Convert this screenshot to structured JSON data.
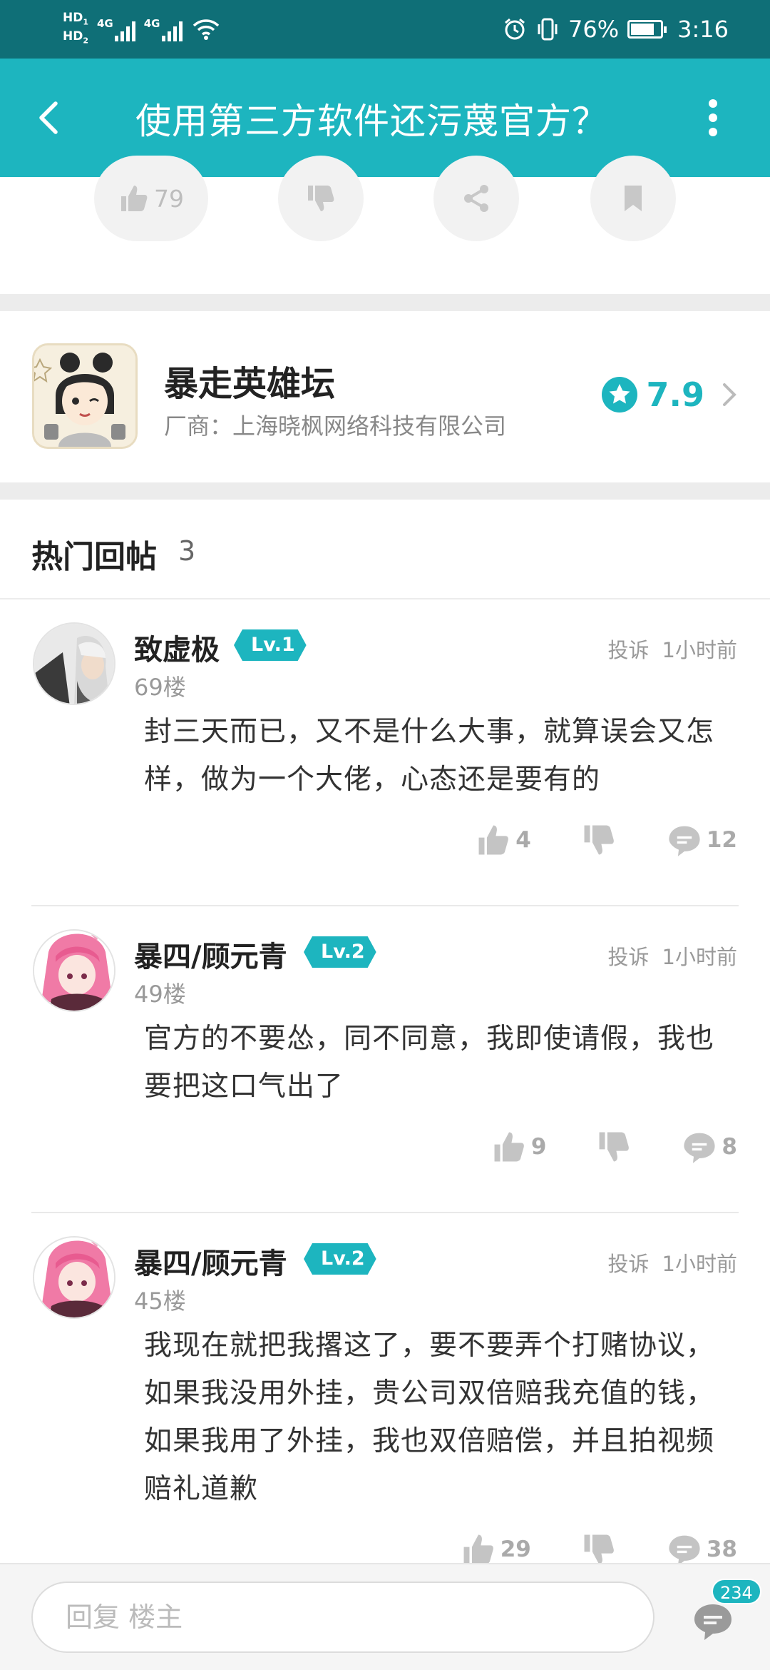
{
  "status_bar": {
    "hd1": "HD",
    "hd1_sub": "1",
    "hd2": "HD",
    "hd2_sub": "2",
    "net1": "4G",
    "net2": "4G",
    "battery_pct": "76%",
    "time": "3:16"
  },
  "app_bar": {
    "title": "使用第三方软件还污蔑官方？"
  },
  "post_actions": {
    "like_count": "79"
  },
  "game": {
    "name": "暴走英雄坛",
    "vendor": "厂商：上海晓枫网络科技有限公司",
    "rating": "7.9"
  },
  "section": {
    "title": "热门回帖",
    "count": "3"
  },
  "comments": [
    {
      "user": "致虚极",
      "level": "Lv.1",
      "floor": "69楼",
      "report": "投诉",
      "time": "1小时前",
      "body": "封三天而已，又不是什么大事，就算误会又怎样，做为一个大佬，心态还是要有的",
      "likes": "4",
      "replies": "12"
    },
    {
      "user": "暴四/顾元青",
      "level": "Lv.2",
      "floor": "49楼",
      "report": "投诉",
      "time": "1小时前",
      "body": "官方的不要怂，同不同意，我即使请假，我也要把这口气出了",
      "likes": "9",
      "replies": "8"
    },
    {
      "user": "暴四/顾元青",
      "level": "Lv.2",
      "floor": "45楼",
      "report": "投诉",
      "time": "1小时前",
      "body": "我现在就把我撂这了，要不要弄个打赌协议，如果我没用外挂，贵公司双倍赔我充值的钱，如果我用了外挂，我也双倍赔偿，并且拍视频赔礼道歉",
      "likes": "29",
      "replies": "38"
    }
  ],
  "bottom_bar": {
    "placeholder": "回复  楼主",
    "comment_count": "234"
  },
  "colors": {
    "accent": "#1db5bf",
    "status_bar": "#0f6f77"
  }
}
